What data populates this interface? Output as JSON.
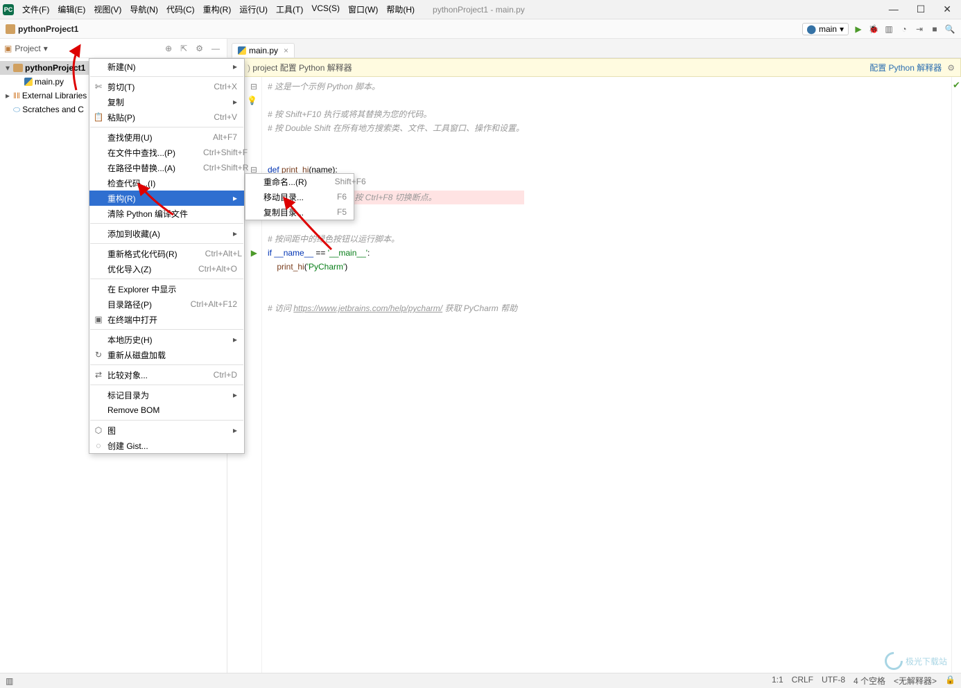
{
  "window": {
    "title": "pythonProject1 - main.py"
  },
  "menubar": [
    "文件(F)",
    "编辑(E)",
    "视图(V)",
    "导航(N)",
    "代码(C)",
    "重构(R)",
    "运行(U)",
    "工具(T)",
    "VCS(S)",
    "窗口(W)",
    "帮助(H)"
  ],
  "breadcrumb": "pythonProject1",
  "run_config": "main",
  "project_panel": {
    "title": "Project",
    "items": [
      {
        "label": "pythonProject1",
        "kind": "folder-open",
        "selected": true,
        "depth": 0
      },
      {
        "label": "main.py",
        "kind": "py",
        "depth": 1
      },
      {
        "label": "External Libraries",
        "kind": "lib",
        "depth": 0,
        "icon": "‖"
      },
      {
        "label": "Scratches and C",
        "kind": "scratch",
        "depth": 0
      }
    ]
  },
  "tab": {
    "name": "main.py"
  },
  "banner": {
    "msg": "project 配置 Python 解释器",
    "link": "配置 Python 解释器"
  },
  "code_lines": [
    "# 这是一个示例 Python 脚本。",
    "",
    "# 按 Shift+F10 执行或将其替换为您的代码。",
    "# 按 Double Shift 在所有地方搜索类、文件、工具窗口、操作和设置。",
    "",
    "",
    "def print_hi(name):",
    "    ",
    "    print(f'Hi, {name}')  # 按 Ctrl+F8 切换断点。",
    "",
    "",
    "# 按间距中的绿色按钮以运行脚本。",
    "if __name__ == '__main__':",
    "    print_hi('PyCharm')",
    "",
    "",
    "# 访问 https://www.jetbrains.com/help/pycharm/ 获取 PyCharm 帮助"
  ],
  "highlight_line_index": 8,
  "context_menu": {
    "items": [
      {
        "label": "新建(N)",
        "submenu": true
      },
      "---",
      {
        "label": "剪切(T)",
        "icon": "✄",
        "shortcut": "Ctrl+X"
      },
      {
        "label": "复制",
        "submenu": true
      },
      {
        "label": "粘贴(P)",
        "icon": "📋",
        "shortcut": "Ctrl+V"
      },
      "---",
      {
        "label": "查找使用(U)",
        "shortcut": "Alt+F7"
      },
      {
        "label": "在文件中查找...(P)",
        "shortcut": "Ctrl+Shift+F"
      },
      {
        "label": "在路径中替换...(A)",
        "shortcut": "Ctrl+Shift+R"
      },
      {
        "label": "检查代码...(I)"
      },
      {
        "label": "重构(R)",
        "submenu": true,
        "selected": true
      },
      {
        "label": "清除 Python 编译文件"
      },
      "---",
      {
        "label": "添加到收藏(A)",
        "submenu": true
      },
      "---",
      {
        "label": "重新格式化代码(R)",
        "shortcut": "Ctrl+Alt+L"
      },
      {
        "label": "优化导入(Z)",
        "shortcut": "Ctrl+Alt+O"
      },
      "---",
      {
        "label": "在 Explorer 中显示"
      },
      {
        "label": "目录路径(P)",
        "shortcut": "Ctrl+Alt+F12"
      },
      {
        "label": "在终端中打开",
        "icon": "▣"
      },
      "---",
      {
        "label": "本地历史(H)",
        "submenu": true
      },
      {
        "label": "重新从磁盘加载",
        "icon": "↻"
      },
      "---",
      {
        "label": "比较对象...",
        "icon": "⇄",
        "shortcut": "Ctrl+D"
      },
      "---",
      {
        "label": "标记目录为",
        "submenu": true
      },
      {
        "label": "Remove BOM"
      },
      "---",
      {
        "label": "图",
        "icon": "⬡",
        "submenu": true
      },
      {
        "label": "创建 Gist...",
        "icon": "◌"
      }
    ]
  },
  "sub_menu": {
    "items": [
      {
        "label": "重命名...(R)",
        "shortcut": "Shift+F6"
      },
      {
        "label": "移动目录...",
        "shortcut": "F6"
      },
      {
        "label": "复制目录...",
        "shortcut": "F5"
      }
    ]
  },
  "statusbar": {
    "pos": "1:1",
    "sep": "CRLF",
    "enc": "UTF-8",
    "indent": "4 个空格",
    "interp": "<无解释器>"
  },
  "watermark": "极光下载站"
}
